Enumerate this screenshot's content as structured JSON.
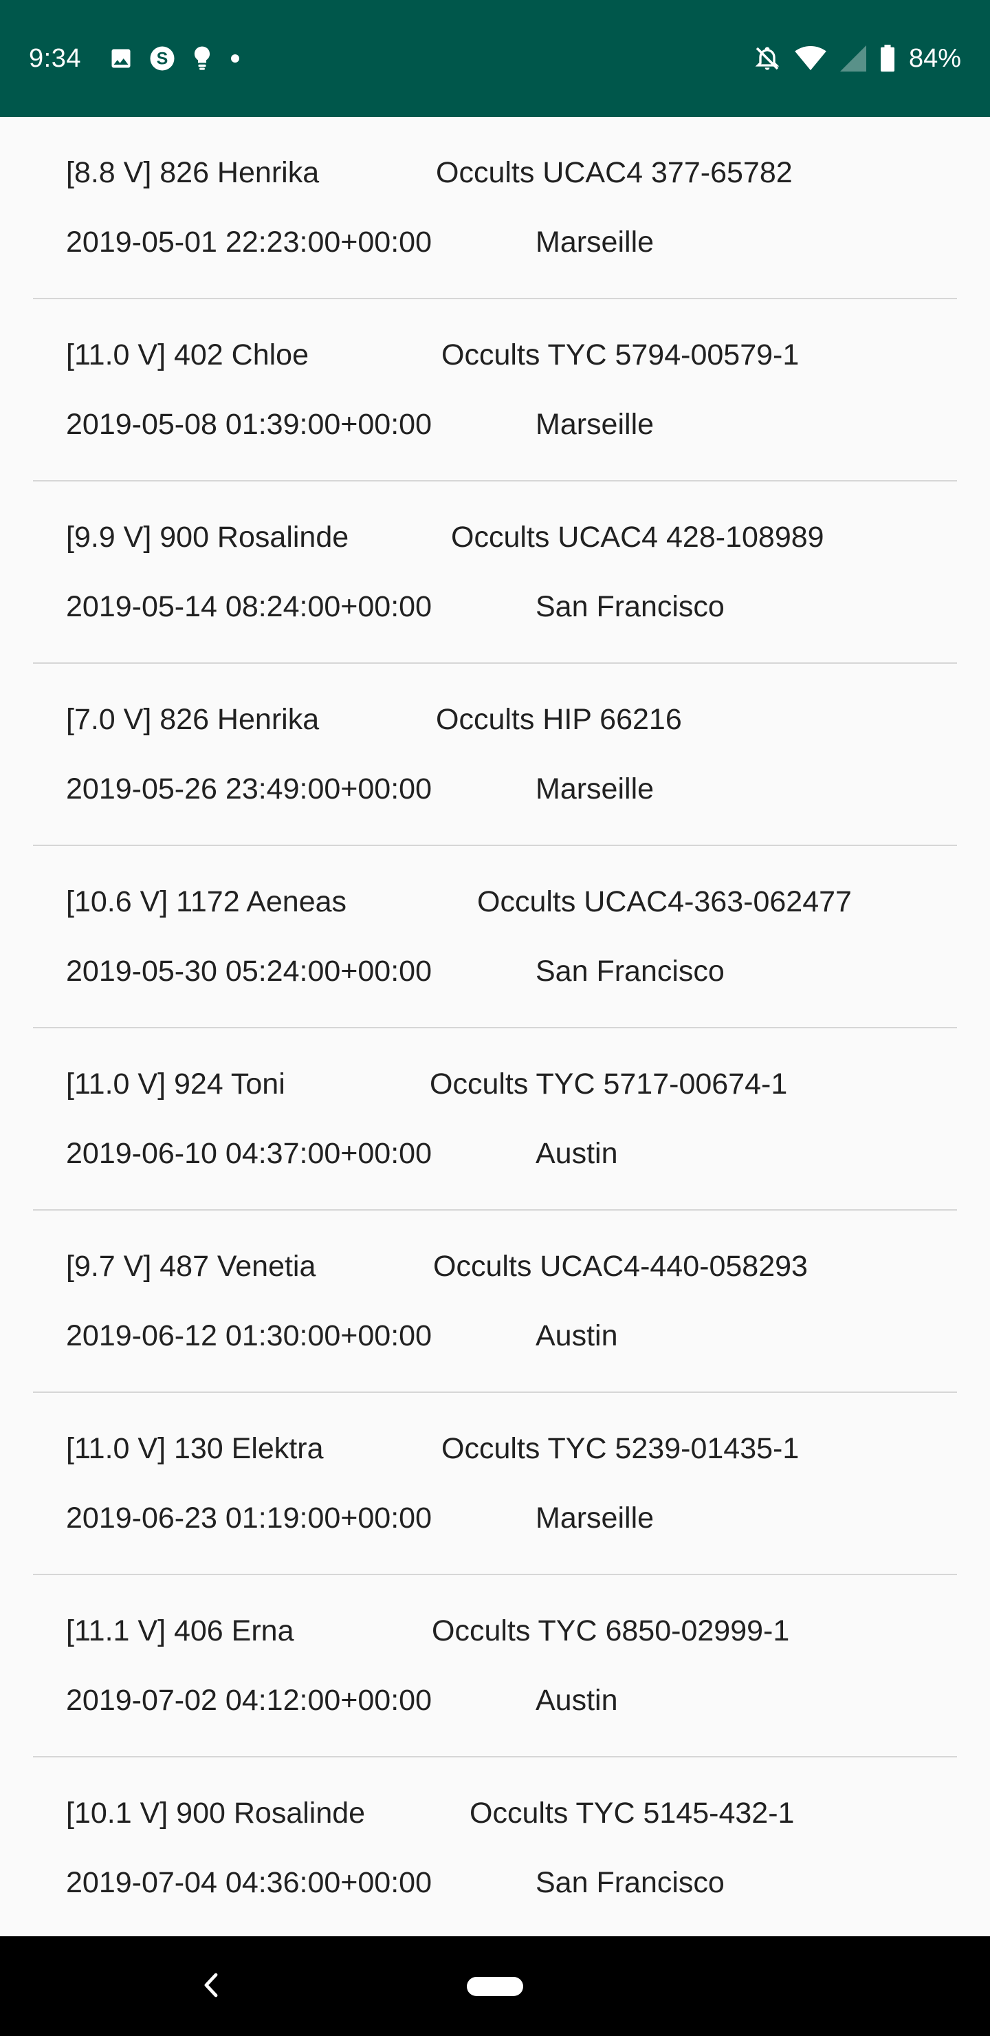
{
  "status_bar": {
    "time": "9:34",
    "battery_percent": "84%",
    "background_color": "#00574b",
    "left_icons": [
      "image-icon",
      "skype-icon",
      "lightbulb-icon",
      "dot-icon"
    ],
    "right_icons": [
      "notifications-off-icon",
      "wifi-icon",
      "cell-signal-icon",
      "battery-icon"
    ]
  },
  "occultations": [
    {
      "asteroid": "[8.8 V] 826 Henrika",
      "star": "Occults UCAC4 377-65782",
      "datetime": "2019-05-01 22:23:00+00:00",
      "location": "Marseille"
    },
    {
      "asteroid": "[11.0 V] 402 Chloe",
      "star": "Occults TYC 5794-00579-1",
      "datetime": "2019-05-08 01:39:00+00:00",
      "location": "Marseille"
    },
    {
      "asteroid": "[9.9 V] 900 Rosalinde",
      "star": "Occults UCAC4 428-108989",
      "datetime": "2019-05-14 08:24:00+00:00",
      "location": "San Francisco"
    },
    {
      "asteroid": "[7.0 V] 826 Henrika",
      "star": "Occults HIP 66216",
      "datetime": "2019-05-26 23:49:00+00:00",
      "location": "Marseille"
    },
    {
      "asteroid": "[10.6 V] 1172 Aeneas",
      "star": "Occults UCAC4-363-062477",
      "datetime": "2019-05-30 05:24:00+00:00",
      "location": "San Francisco"
    },
    {
      "asteroid": "[11.0 V] 924 Toni",
      "star": "Occults TYC 5717-00674-1",
      "datetime": "2019-06-10 04:37:00+00:00",
      "location": "Austin"
    },
    {
      "asteroid": "[9.7 V] 487 Venetia",
      "star": "Occults UCAC4-440-058293",
      "datetime": "2019-06-12 01:30:00+00:00",
      "location": "Austin"
    },
    {
      "asteroid": "[11.0 V] 130 Elektra",
      "star": "Occults TYC 5239-01435-1",
      "datetime": "2019-06-23 01:19:00+00:00",
      "location": "Marseille"
    },
    {
      "asteroid": "[11.1 V] 406 Erna",
      "star": "Occults TYC 6850-02999-1",
      "datetime": "2019-07-02 04:12:00+00:00",
      "location": "Austin"
    },
    {
      "asteroid": "[10.1 V] 900 Rosalinde",
      "star": "Occults TYC 5145-432-1",
      "datetime": "2019-07-04 04:36:00+00:00",
      "location": "San Francisco"
    }
  ],
  "nav_bar": {
    "buttons": [
      "back-icon",
      "home-pill-icon"
    ]
  }
}
